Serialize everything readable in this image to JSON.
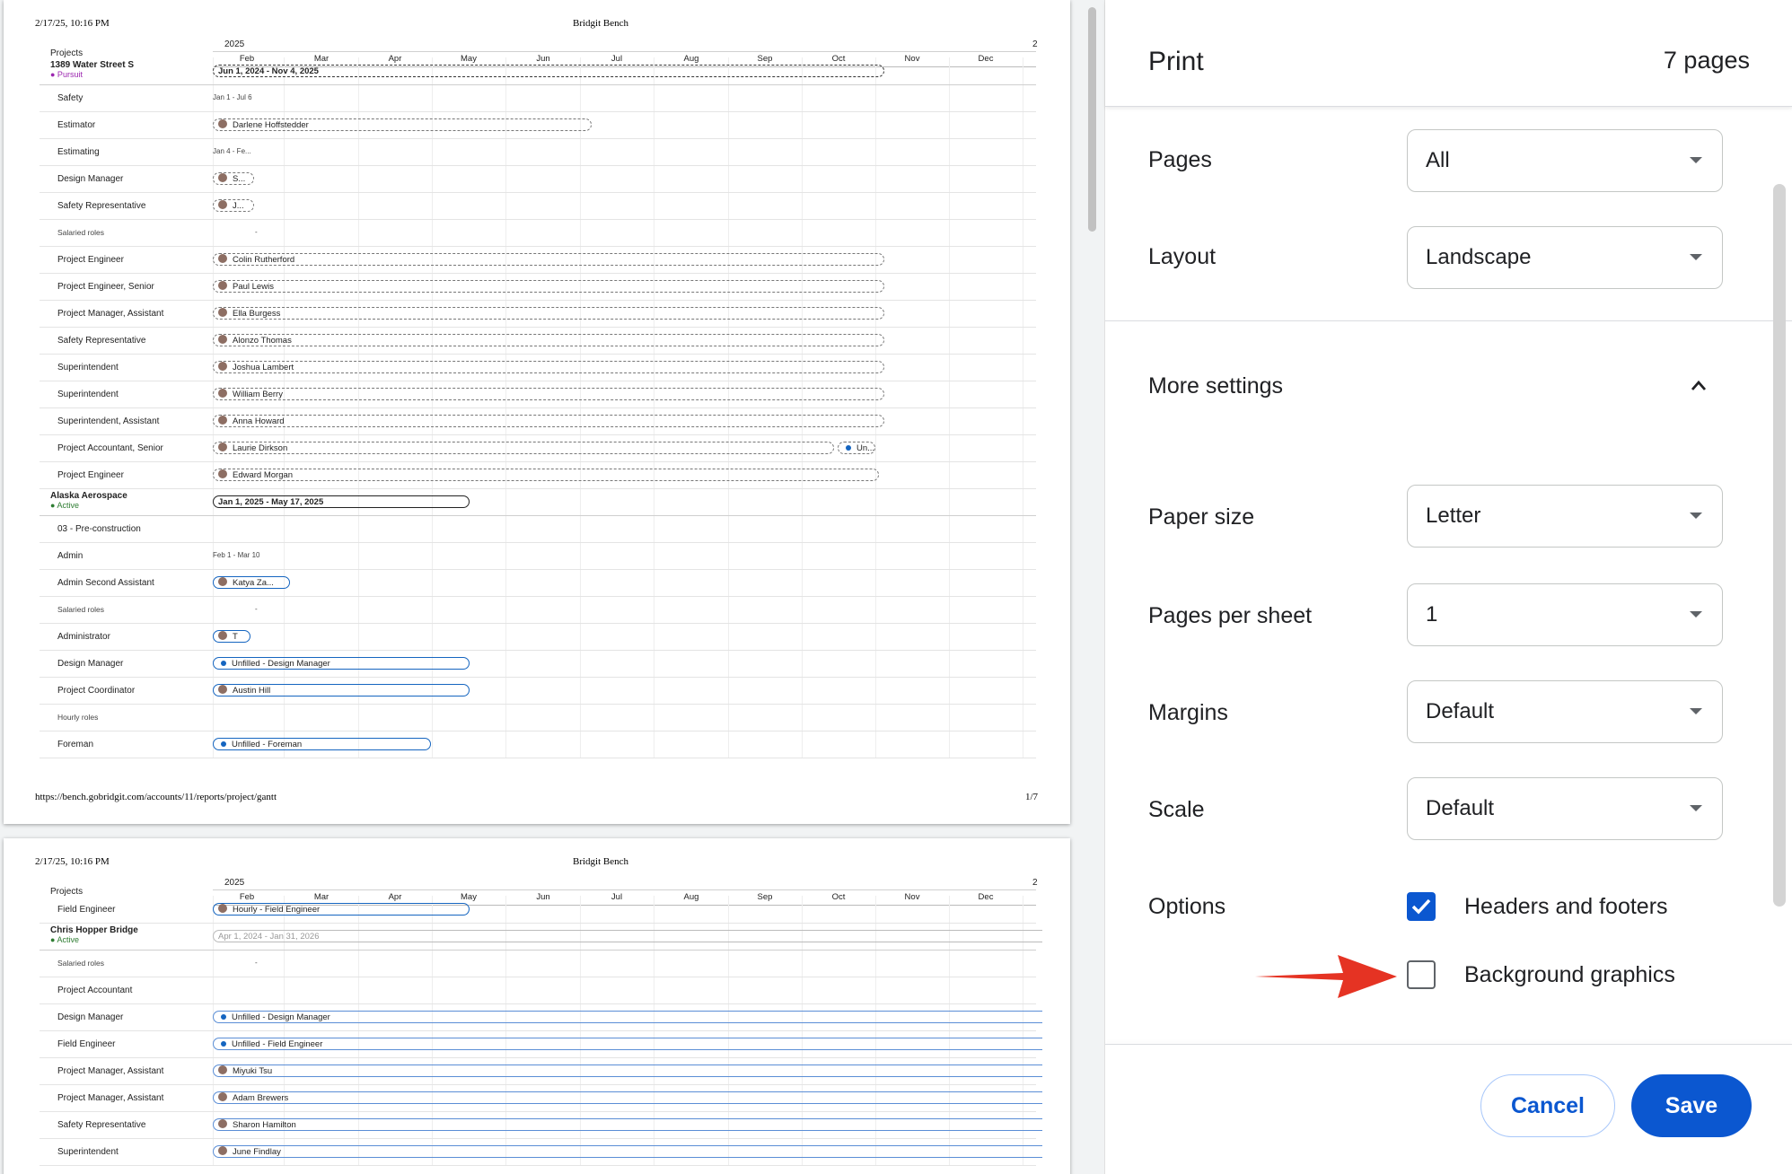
{
  "preview": {
    "page_header_date": "2/17/25, 10:16 PM",
    "page_header_title": "Bridgit Bench",
    "page_footer_url": "https://bench.gobridgit.com/accounts/11/reports/project/gantt",
    "page1_number": "1/7",
    "projects_label": "Projects",
    "year": "2025",
    "next_year_partial": "2",
    "months": [
      "Feb",
      "Mar",
      "Apr",
      "May",
      "Jun",
      "Jul",
      "Aug",
      "Sep",
      "Oct",
      "Nov",
      "Dec"
    ],
    "page1_rows": [
      {
        "type": "project",
        "label": "1389 Water Street S",
        "status": "● Pursuit",
        "status_color": "#9c27b0",
        "bar": "Jun 1, 2024 - Nov 4, 2025"
      },
      {
        "label": "Safety",
        "tiny": "Jan 1 - Jul 6"
      },
      {
        "label": "Estimator",
        "bar": "Darlene Hoffstedder"
      },
      {
        "label": "Estimating",
        "tiny": "Jan 4 - Fe..."
      },
      {
        "label": "Design Manager",
        "bar": "S..."
      },
      {
        "label": "Safety Representative",
        "bar": "J..."
      },
      {
        "label": "Salaried roles",
        "small": true,
        "tiny": "-"
      },
      {
        "label": "Project Engineer",
        "bar": "Colin Rutherford"
      },
      {
        "label": "Project Engineer, Senior",
        "bar": "Paul Lewis"
      },
      {
        "label": "Project Manager, Assistant",
        "bar": "Ella Burgess"
      },
      {
        "label": "Safety Representative",
        "bar": "Alonzo Thomas"
      },
      {
        "label": "Superintendent",
        "bar": "Joshua Lambert"
      },
      {
        "label": "Superintendent",
        "bar": "William Berry"
      },
      {
        "label": "Superintendent, Assistant",
        "bar": "Anna Howard"
      },
      {
        "label": "Project Accountant, Senior",
        "bar": "Laurie Dirkson",
        "bar2": "Un..."
      },
      {
        "label": "Project Engineer",
        "bar": "Edward Morgan"
      },
      {
        "type": "project",
        "label": "Alaska Aerospace",
        "status": "● Active",
        "status_color": "#2e7d32",
        "bar": "Jan 1, 2025 - May 17, 2025"
      },
      {
        "label": "03 - Pre-construction"
      },
      {
        "label": "Admin",
        "tiny": "Feb 1 - Mar 10"
      },
      {
        "label": "Admin Second Assistant",
        "bar": "Katya Za..."
      },
      {
        "label": "Salaried roles",
        "small": true,
        "tiny": "-"
      },
      {
        "label": "Administrator",
        "bar": "T"
      },
      {
        "label": "Design Manager",
        "bar": "Unfilled - Design Manager"
      },
      {
        "label": "Project Coordinator",
        "bar": "Austin Hill"
      },
      {
        "label": "Hourly roles",
        "small": true
      },
      {
        "label": "Foreman",
        "bar": "Unfilled - Foreman"
      }
    ],
    "page2_rows": [
      {
        "label": "Field Engineer",
        "bar": "Hourly - Field Engineer"
      },
      {
        "type": "project",
        "label": "Chris Hopper Bridge",
        "status": "● Active",
        "status_color": "#2e7d32",
        "bar": "Apr 1, 2024 - Jan 31, 2026"
      },
      {
        "label": "Salaried roles",
        "small": true,
        "tiny": "-"
      },
      {
        "label": "Project Accountant"
      },
      {
        "label": "Design Manager",
        "bar": "Unfilled - Design Manager"
      },
      {
        "label": "Field Engineer",
        "bar": "Unfilled - Field Engineer"
      },
      {
        "label": "Project Manager, Assistant",
        "bar": "Miyuki Tsu"
      },
      {
        "label": "Project Manager, Assistant",
        "bar": "Adam Brewers"
      },
      {
        "label": "Safety Representative",
        "bar": "Sharon Hamilton"
      },
      {
        "label": "Superintendent",
        "bar": "June Findlay"
      }
    ]
  },
  "settings": {
    "title": "Print",
    "page_count": "7 pages",
    "pages_label": "Pages",
    "pages_value": "All",
    "layout_label": "Layout",
    "layout_value": "Landscape",
    "more_settings_label": "More settings",
    "paper_size_label": "Paper size",
    "paper_size_value": "Letter",
    "pages_per_sheet_label": "Pages per sheet",
    "pages_per_sheet_value": "1",
    "margins_label": "Margins",
    "margins_value": "Default",
    "scale_label": "Scale",
    "scale_value": "Default",
    "options_label": "Options",
    "headers_footers_label": "Headers and footers",
    "headers_footers_checked": true,
    "background_graphics_label": "Background graphics",
    "background_graphics_checked": false,
    "cancel_label": "Cancel",
    "save_label": "Save",
    "accent_color": "#0b57d0",
    "arrow_color": "#e53323"
  }
}
